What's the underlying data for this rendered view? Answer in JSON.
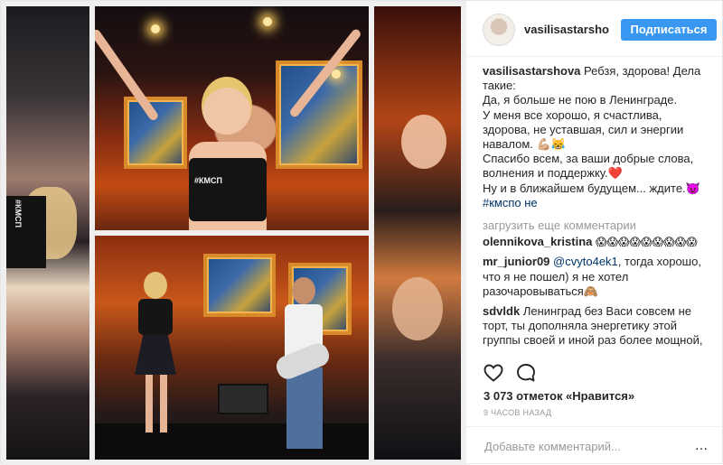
{
  "post": {
    "author": {
      "username": "vasilisastarsho",
      "follow_label": "Подписаться"
    },
    "media": {
      "shirt_text": "#КМСП",
      "side_shirt_text": "#КМСП"
    },
    "caption": {
      "username": "vasilisastarshova",
      "text": "Ребзя, здорова! Дела такие:\nДа, я больше не пою в Ленинграде.\nУ меня все хорошо, я счастлива, здорова, не уставшая, сил и энергии навалом. 💪🏼😹",
      "text2": "Спасибо всем, за ваши добрые слова, волнения и поддержку.❤️\nНу и в ближайшем будущем... ждите.😈",
      "hashtag": "#кмспо     не"
    },
    "load_more_label": "загрузить еще комментарии",
    "comments": [
      {
        "username": "olennikova_kristina",
        "text": "😱😱😱😱😱😱😱😱😱"
      },
      {
        "username": "mr_junior09",
        "mention": "@cvyto4ek1",
        "text": ", тогда хорошо, что я не пошел) я не хотел разочаровываться🙈"
      },
      {
        "username": "sdvldk",
        "text": "Ленинград без Васи совсем не торт, ты дополняла энергетику этой группы своей и иной раз более мощной,"
      }
    ],
    "likes_text": "3 073 отметок «Нравится»",
    "timestamp": "9 ЧАСОВ НАЗАД",
    "add_comment_placeholder": "Добавьте комментарий...",
    "more_icon": "…",
    "icons": {
      "like": "heart-icon",
      "comment": "comment-bubble-icon",
      "more": "ellipsis-icon"
    },
    "colors": {
      "follow_button": "#3897f0",
      "link": "#003569",
      "muted": "#999999"
    }
  }
}
